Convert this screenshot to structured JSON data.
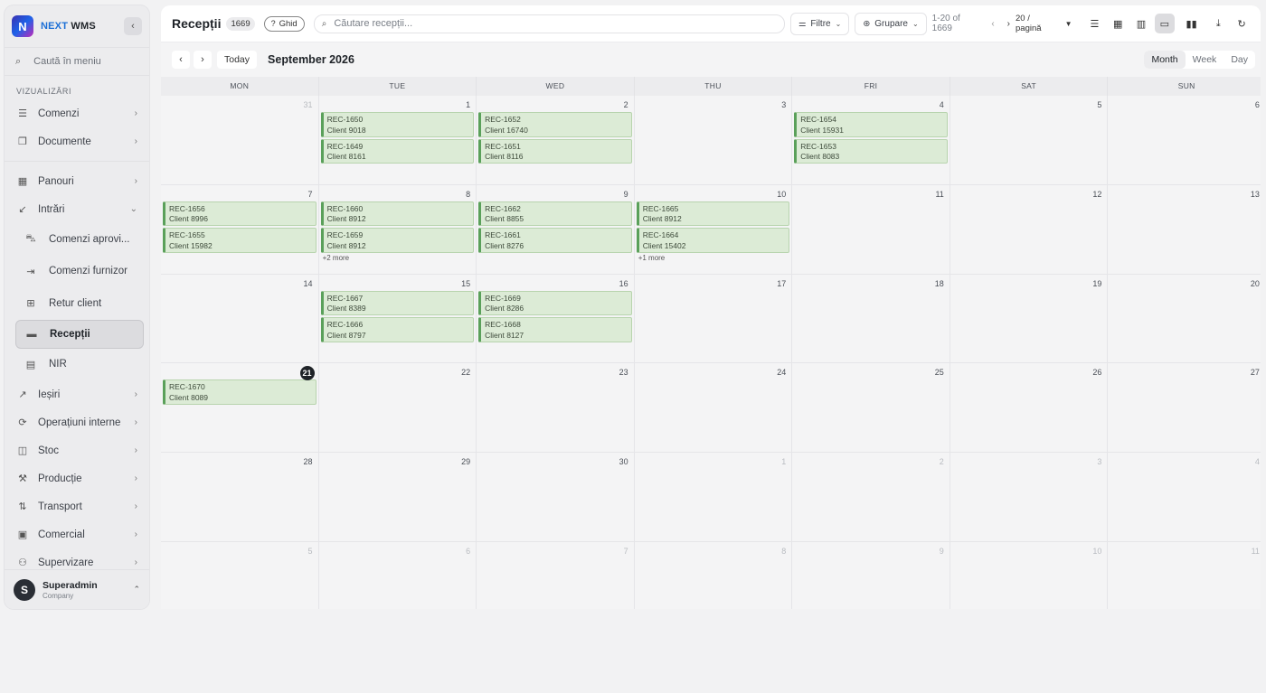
{
  "app": {
    "brand_first": "NEXT",
    "brand_second": "WMS",
    "logo_letter": "N",
    "accent": "#1c6fd6"
  },
  "sidebar": {
    "search_placeholder": "Caută în meniu",
    "section_label": "VIZUALIZĂRI",
    "top_items": [
      {
        "label": "Comenzi",
        "icon": "list-icon"
      },
      {
        "label": "Documente",
        "icon": "copy-icon"
      }
    ],
    "items": [
      {
        "label": "Panouri",
        "icon": "dashboard-icon"
      },
      {
        "label": "Intrări",
        "icon": "arrow-in-icon"
      }
    ],
    "sub_items": [
      {
        "label": "Comenzi aprovi..."
      },
      {
        "label": "Comenzi furnizor"
      },
      {
        "label": "Retur client"
      },
      {
        "label": "Recepții"
      },
      {
        "label": "NIR"
      }
    ],
    "bottom_items": [
      {
        "label": "Ieșiri"
      },
      {
        "label": "Operațiuni interne"
      },
      {
        "label": "Stoc"
      },
      {
        "label": "Producție"
      },
      {
        "label": "Transport"
      },
      {
        "label": "Comercial"
      },
      {
        "label": "Supervizare"
      }
    ],
    "user": {
      "initial": "S",
      "name": "Superadmin",
      "company": "Company"
    }
  },
  "topbar": {
    "title": "Recepții",
    "count": "1669",
    "guide_label": "Ghid",
    "search_placeholder": "Căutare recepții...",
    "filters_label": "Filtre",
    "group_label": "Grupare",
    "range_text": "1-20 of 1669",
    "per_page": "20 / pagină"
  },
  "calendar": {
    "today_label": "Today",
    "month_title": "September 2026",
    "views": [
      "Month",
      "Week",
      "Day"
    ],
    "active_view": "Month",
    "weekdays": [
      "MON",
      "TUE",
      "WED",
      "THU",
      "FRI",
      "SAT",
      "SUN"
    ],
    "weeks": [
      [
        {
          "num": "31",
          "muted": true,
          "events": []
        },
        {
          "num": "1",
          "events": [
            {
              "id": "REC-1650",
              "client": "Client 9018"
            },
            {
              "id": "REC-1649",
              "client": "Client 8161"
            }
          ]
        },
        {
          "num": "2",
          "events": [
            {
              "id": "REC-1652",
              "client": "Client 16740"
            },
            {
              "id": "REC-1651",
              "client": "Client 8116"
            }
          ]
        },
        {
          "num": "3",
          "events": []
        },
        {
          "num": "4",
          "events": [
            {
              "id": "REC-1654",
              "client": "Client 15931"
            },
            {
              "id": "REC-1653",
              "client": "Client 8083"
            }
          ]
        },
        {
          "num": "5",
          "events": []
        },
        {
          "num": "6",
          "events": []
        }
      ],
      [
        {
          "num": "7",
          "events": [
            {
              "id": "REC-1656",
              "client": "Client 8996"
            },
            {
              "id": "REC-1655",
              "client": "Client 15982"
            }
          ]
        },
        {
          "num": "8",
          "events": [
            {
              "id": "REC-1660",
              "client": "Client 8912"
            },
            {
              "id": "REC-1659",
              "client": "Client 8912"
            }
          ],
          "more": "+2 more"
        },
        {
          "num": "9",
          "events": [
            {
              "id": "REC-1662",
              "client": "Client 8855"
            },
            {
              "id": "REC-1661",
              "client": "Client 8276"
            }
          ]
        },
        {
          "num": "10",
          "events": [
            {
              "id": "REC-1665",
              "client": "Client 8912"
            },
            {
              "id": "REC-1664",
              "client": "Client 15402"
            }
          ],
          "more": "+1 more"
        },
        {
          "num": "11",
          "events": []
        },
        {
          "num": "12",
          "events": []
        },
        {
          "num": "13",
          "events": []
        }
      ],
      [
        {
          "num": "14",
          "events": []
        },
        {
          "num": "15",
          "events": [
            {
              "id": "REC-1667",
              "client": "Client 8389"
            },
            {
              "id": "REC-1666",
              "client": "Client 8797"
            }
          ]
        },
        {
          "num": "16",
          "events": [
            {
              "id": "REC-1669",
              "client": "Client 8286"
            },
            {
              "id": "REC-1668",
              "client": "Client 8127"
            }
          ]
        },
        {
          "num": "17",
          "events": []
        },
        {
          "num": "18",
          "events": []
        },
        {
          "num": "19",
          "events": []
        },
        {
          "num": "20",
          "events": []
        }
      ],
      [
        {
          "num": "21",
          "today": true,
          "events": [
            {
              "id": "REC-1670",
              "client": "Client 8089"
            }
          ]
        },
        {
          "num": "22",
          "events": []
        },
        {
          "num": "23",
          "events": []
        },
        {
          "num": "24",
          "events": []
        },
        {
          "num": "25",
          "events": []
        },
        {
          "num": "26",
          "events": []
        },
        {
          "num": "27",
          "events": []
        }
      ],
      [
        {
          "num": "28",
          "events": []
        },
        {
          "num": "29",
          "events": []
        },
        {
          "num": "30",
          "events": []
        },
        {
          "num": "1",
          "muted": true,
          "events": []
        },
        {
          "num": "2",
          "muted": true,
          "events": []
        },
        {
          "num": "3",
          "muted": true,
          "events": []
        },
        {
          "num": "4",
          "muted": true,
          "events": []
        }
      ],
      [
        {
          "num": "5",
          "muted": true,
          "events": []
        },
        {
          "num": "6",
          "muted": true,
          "events": []
        },
        {
          "num": "7",
          "muted": true,
          "events": []
        },
        {
          "num": "8",
          "muted": true,
          "events": []
        },
        {
          "num": "9",
          "muted": true,
          "events": []
        },
        {
          "num": "10",
          "muted": true,
          "events": []
        },
        {
          "num": "11",
          "muted": true,
          "events": []
        }
      ]
    ]
  }
}
